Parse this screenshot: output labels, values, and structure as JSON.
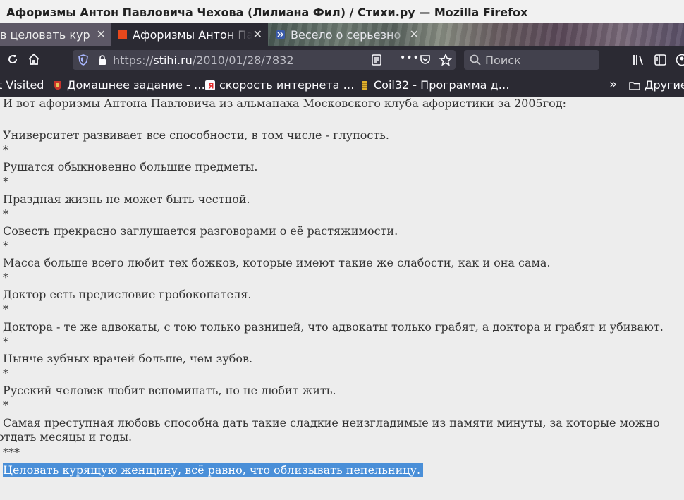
{
  "window": {
    "title": "Афоризмы Антон Павловича Чехова (Лилиана Фил) / Стихи.ру — Mozilla Firefox"
  },
  "tabs": [
    {
      "label": "в целовать куря",
      "active": false
    },
    {
      "label": "Афоризмы Антон Па",
      "active": true
    },
    {
      "label": "Весело о серьезно",
      "active": false
    }
  ],
  "navbar": {
    "url_prefix": "https://",
    "url_host": "stihi.ru",
    "url_path": "/2010/01/28/7832",
    "more": "•••",
    "search_placeholder": "Поиск"
  },
  "bookmarks": [
    {
      "label": "t Visited"
    },
    {
      "label": "Домашнее задание - …"
    },
    {
      "label": "скорость интернета …"
    },
    {
      "label": "Coil32 - Программа д…"
    }
  ],
  "bookmarks_overflow": "»",
  "bookmarks_other": "Другие",
  "content": {
    "intro": "И вот афоризмы Антона Павловича из альманаха Московского клуба афористики за 2005год:",
    "lines": [
      "Университет развивает все способности, в том числе - глупость.",
      "*",
      "Рушатся обыкновенно большие предметы.",
      "*",
      "Праздная жизнь не может быть честной.",
      "*",
      "Совесть прекрасно заглушается разговорами о её растяжимости.",
      "*",
      "Масса больше всего любит тех божков, которые имеют такие же слабости, как и она сама.",
      "*",
      "Доктор есть предисловие гробокопателя.",
      "*",
      "Доктора - те же адвокаты, с тою только разницей, что адвокаты только грабят, а доктора и грабят и убивают.",
      "*",
      "Нынче зубных врачей больше, чем зубов.",
      "*",
      "Русский человек любит вспоминать, но не любит жить.",
      "*"
    ],
    "long_line": "Самая преступная любовь способна дать такие сладкие неизгладимые из памяти минуты, за которые можно отдать месяцы и годы.",
    "separator": "***",
    "selected_line": "Целовать курящую женщину, всё равно, что облизывать пепельницу."
  },
  "colors": {
    "chrome_dark": "#2b2a33",
    "url_field": "#42414d",
    "selection": "#4a8fd8",
    "page_bg": "#ededed"
  }
}
